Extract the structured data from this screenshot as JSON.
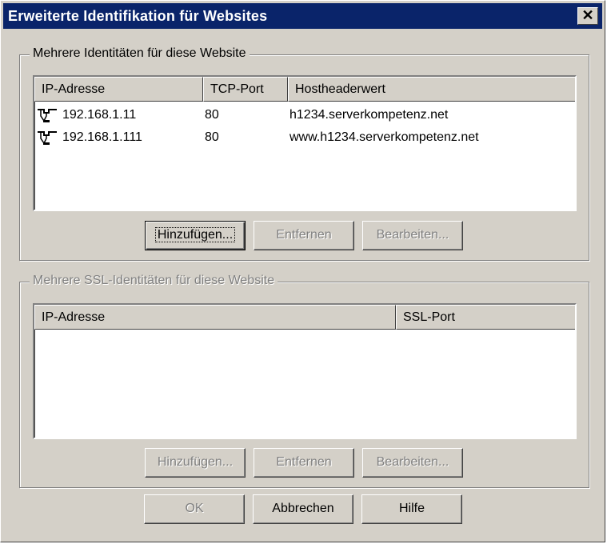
{
  "window": {
    "title": "Erweiterte Identifikation für Websites",
    "close_glyph": "✕"
  },
  "group1": {
    "title": "Mehrere Identitäten für diese Website",
    "columns": [
      "IP-Adresse",
      "TCP-Port",
      "Hostheaderwert"
    ],
    "rows": [
      {
        "ip": "192.168.1.11",
        "port": "80",
        "host": "h1234.serverkompetenz.net",
        "icon": "network-identity-icon"
      },
      {
        "ip": "192.168.1.111",
        "port": "80",
        "host": "www.h1234.serverkompetenz.net",
        "icon": "network-identity-icon"
      }
    ],
    "buttons": {
      "add": "Hinzufügen...",
      "remove": "Entfernen",
      "edit": "Bearbeiten..."
    }
  },
  "group2": {
    "title": "Mehrere SSL-Identitäten für diese Website",
    "columns": [
      "IP-Adresse",
      "SSL-Port"
    ],
    "rows": [],
    "buttons": {
      "add": "Hinzufügen...",
      "remove": "Entfernen",
      "edit": "Bearbeiten..."
    }
  },
  "footer": {
    "ok": "OK",
    "cancel": "Abbrechen",
    "help": "Hilfe"
  }
}
